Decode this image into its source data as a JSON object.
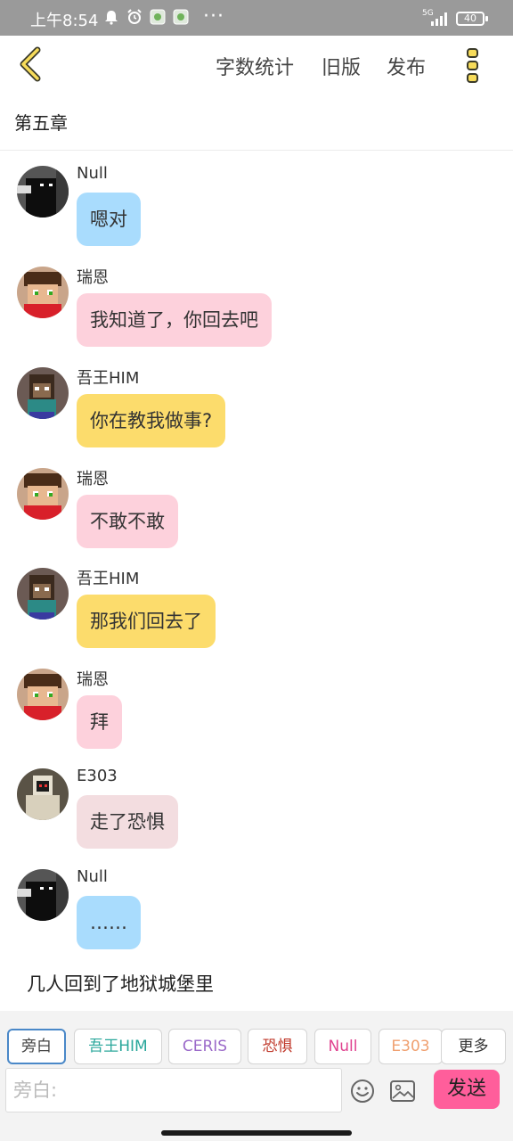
{
  "status_bar": {
    "time": "上午8:54",
    "dots": "···",
    "network": "5G",
    "battery": "40",
    "icons": [
      "notification-bell-icon",
      "alarm-icon",
      "app-icon",
      "app-icon"
    ]
  },
  "header": {
    "word_count": "字数统计",
    "old_version": "旧版",
    "publish": "发布"
  },
  "chapter": {
    "title": "第五章"
  },
  "messages": [
    {
      "speaker": "Null",
      "text": "嗯对",
      "bubble_color": "#a9dcfd",
      "avatar": "null"
    },
    {
      "speaker": "瑞恩",
      "text": "我知道了，你回去吧",
      "bubble_color": "#fdd1dc",
      "avatar": "ryan"
    },
    {
      "speaker": "吾王HIM",
      "text": "你在教我做事?",
      "bubble_color": "#fcdc6c",
      "avatar": "him"
    },
    {
      "speaker": "瑞恩",
      "text": "不敢不敢",
      "bubble_color": "#fdd1dc",
      "avatar": "ryan"
    },
    {
      "speaker": "吾王HIM",
      "text": "那我们回去了",
      "bubble_color": "#fcdc6c",
      "avatar": "him"
    },
    {
      "speaker": "瑞恩",
      "text": "拜",
      "bubble_color": "#fdd1dc",
      "avatar": "ryan"
    },
    {
      "speaker": "E303",
      "text": "走了恐惧",
      "bubble_color": "#f3dde0",
      "avatar": "e303"
    },
    {
      "speaker": "Null",
      "text": "……",
      "bubble_color": "#a9dcfd",
      "avatar": "null"
    }
  ],
  "narration": "几人回到了地狱城堡里",
  "role_chips": [
    {
      "label": "旁白",
      "color": "#444444"
    },
    {
      "label": "吾王HIM",
      "color": "#2aa79b"
    },
    {
      "label": "CERIS",
      "color": "#9b6ac9"
    },
    {
      "label": "恐惧",
      "color": "#c0392b"
    },
    {
      "label": "Null",
      "color": "#e0428f"
    },
    {
      "label": "E303",
      "color": "#f0a070"
    },
    {
      "label": "更多",
      "color": "#333333"
    }
  ],
  "input": {
    "placeholder": "旁白:",
    "value": ""
  },
  "send_label": "发送",
  "accent_color": "#ff5e9b"
}
